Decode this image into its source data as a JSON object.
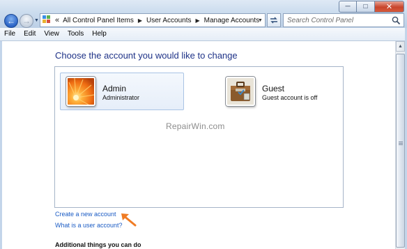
{
  "window": {
    "controls": {
      "minimize_glyph": "─",
      "maximize_glyph": "□",
      "close_glyph": "✕"
    }
  },
  "navigation": {
    "back_icon": "back-arrow-icon",
    "forward_icon": "forward-arrow-icon",
    "recent_pages_icon": "chevron-down-icon",
    "breadcrumb_overflow": "«",
    "breadcrumbs": [
      "All Control Panel Items",
      "User Accounts",
      "Manage Accounts"
    ],
    "refresh_icon": "refresh-icon",
    "search_placeholder": "Search Control Panel"
  },
  "menubar": {
    "items": [
      "File",
      "Edit",
      "View",
      "Tools",
      "Help"
    ]
  },
  "main": {
    "heading": "Choose the account you would like to change",
    "accounts": [
      {
        "name": "Admin",
        "subtitle": "Administrator",
        "picture": "orange-flower-avatar",
        "selected": true
      },
      {
        "name": "Guest",
        "subtitle": "Guest account is off",
        "picture": "guest-suitcase-avatar",
        "selected": false
      }
    ],
    "watermark": "RepairWin.com",
    "links": {
      "create_account": "Create a new account",
      "what_is": "What is a user account?"
    },
    "annotation_color": "#f07c24",
    "additional_heading": "Additional things you can do"
  },
  "colors": {
    "heading": "#1e3287",
    "link": "#1a5bc4",
    "chrome": "#c9daec"
  }
}
